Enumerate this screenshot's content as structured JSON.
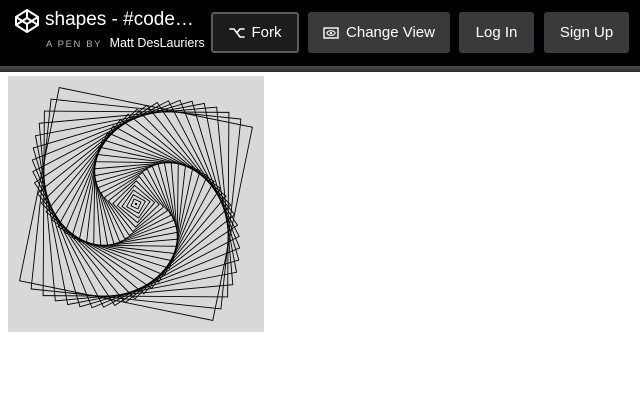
{
  "header": {
    "title": "shapes - #codevember",
    "byline_prefix": "A PEN BY",
    "author": "Matt DesLauriers",
    "logo_icon": "codepen-logo-icon"
  },
  "buttons": {
    "fork": {
      "label": "Fork",
      "icon": "fork-icon"
    },
    "change_view": {
      "label": "Change View",
      "icon": "eye-icon"
    },
    "login": {
      "label": "Log In"
    },
    "signup": {
      "label": "Sign Up"
    }
  },
  "preview": {
    "background": "#d8d8d8",
    "stroke": "#000000"
  }
}
